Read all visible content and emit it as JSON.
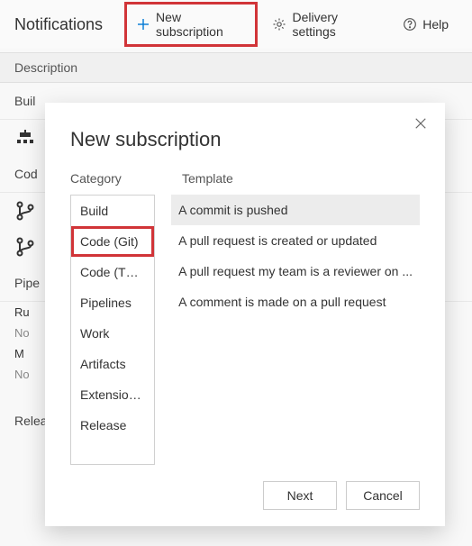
{
  "toolbar": {
    "title": "Notifications",
    "new_subscription_label": "New subscription",
    "delivery_settings_label": "Delivery settings",
    "help_label": "Help"
  },
  "list_header": "Description",
  "background": {
    "sections": [
      "Buil",
      "Cod",
      "Pipe",
      "Release"
    ],
    "rows": [
      "Ru",
      "No",
      "M",
      "No"
    ]
  },
  "modal": {
    "title": "New subscription",
    "category_label": "Category",
    "template_label": "Template",
    "categories": [
      "Build",
      "Code (Git)",
      "Code (TFVC)",
      "Pipelines",
      "Work",
      "Artifacts",
      "Extension ...",
      "Release"
    ],
    "selected_category_index": 1,
    "templates": [
      "A commit is pushed",
      "A pull request is created or updated",
      "A pull request my team is a reviewer on ...",
      "A comment is made on a pull request"
    ],
    "selected_template_index": 0,
    "footer": {
      "next_label": "Next",
      "cancel_label": "Cancel"
    }
  }
}
